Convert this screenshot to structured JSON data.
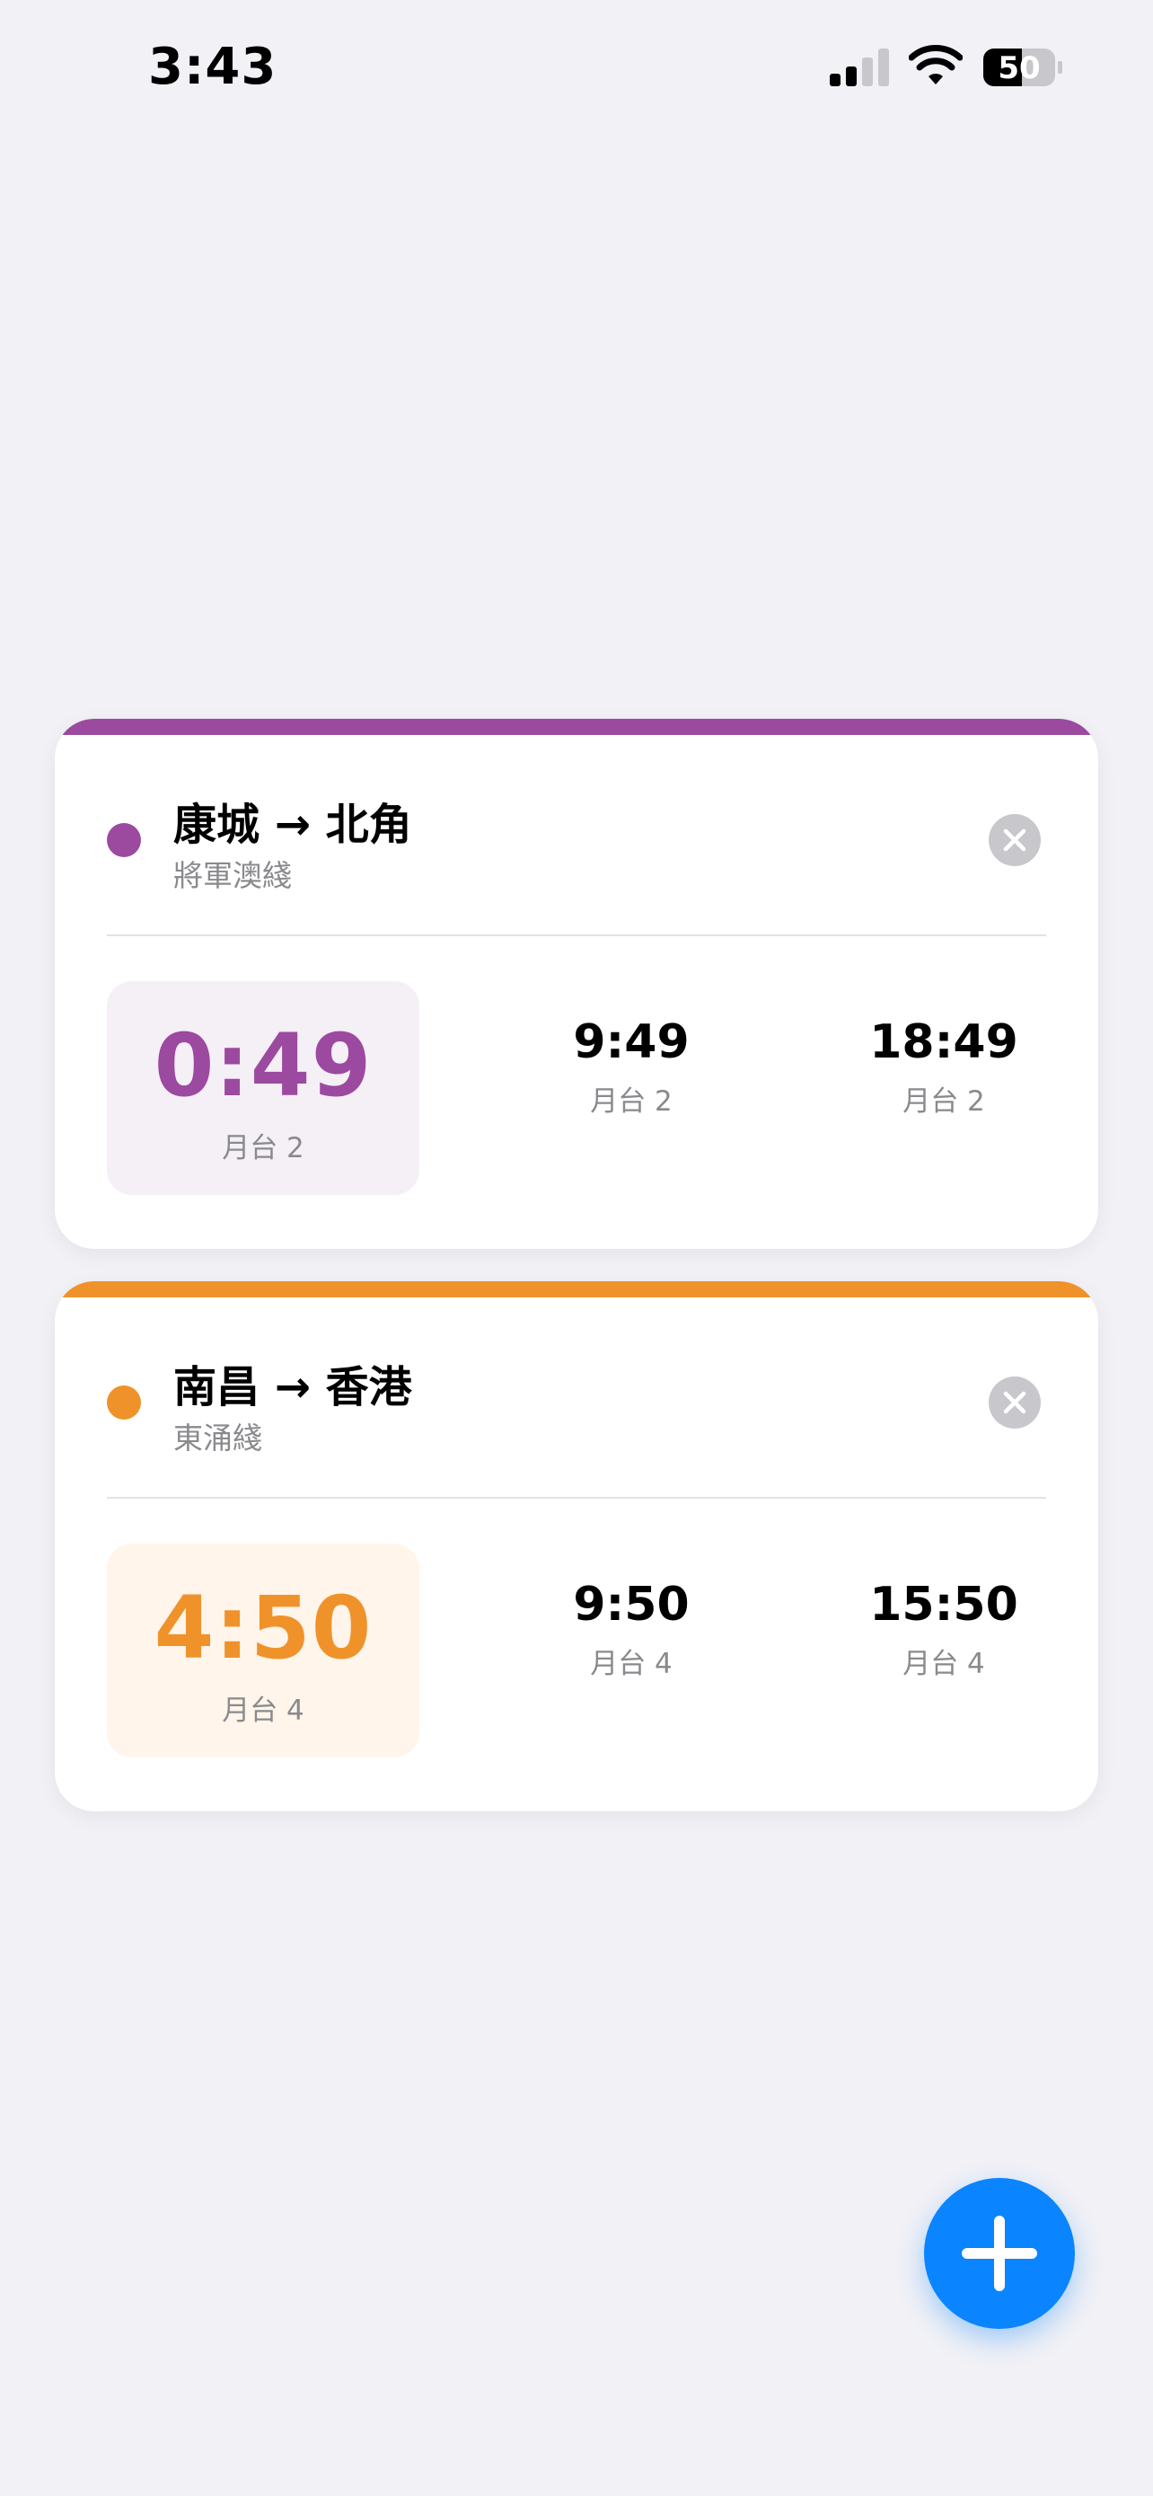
{
  "status_bar": {
    "time": "3:43",
    "battery_level": "50",
    "signal_icon": "cellular-signal-icon",
    "wifi_icon": "wifi-icon",
    "battery_icon": "battery-icon"
  },
  "routes": [
    {
      "from": "康城",
      "arrow": "→",
      "to": "北角",
      "line": "將軍澳綫",
      "color": "#9b4aa0",
      "next": {
        "time": "0:49",
        "platform": "月台 2"
      },
      "departures": [
        {
          "time": "9:49",
          "platform": "月台 2"
        },
        {
          "time": "18:49",
          "platform": "月台 2"
        }
      ]
    },
    {
      "from": "南昌",
      "arrow": "→",
      "to": "香港",
      "line": "東涌綫",
      "color": "#f0922a",
      "next": {
        "time": "4:50",
        "platform": "月台 4"
      },
      "departures": [
        {
          "time": "9:50",
          "platform": "月台 4"
        },
        {
          "time": "15:50",
          "platform": "月台 4"
        }
      ]
    }
  ],
  "icons": {
    "close": "close-icon",
    "add": "plus-icon"
  },
  "fab_color": "#0a84ff"
}
